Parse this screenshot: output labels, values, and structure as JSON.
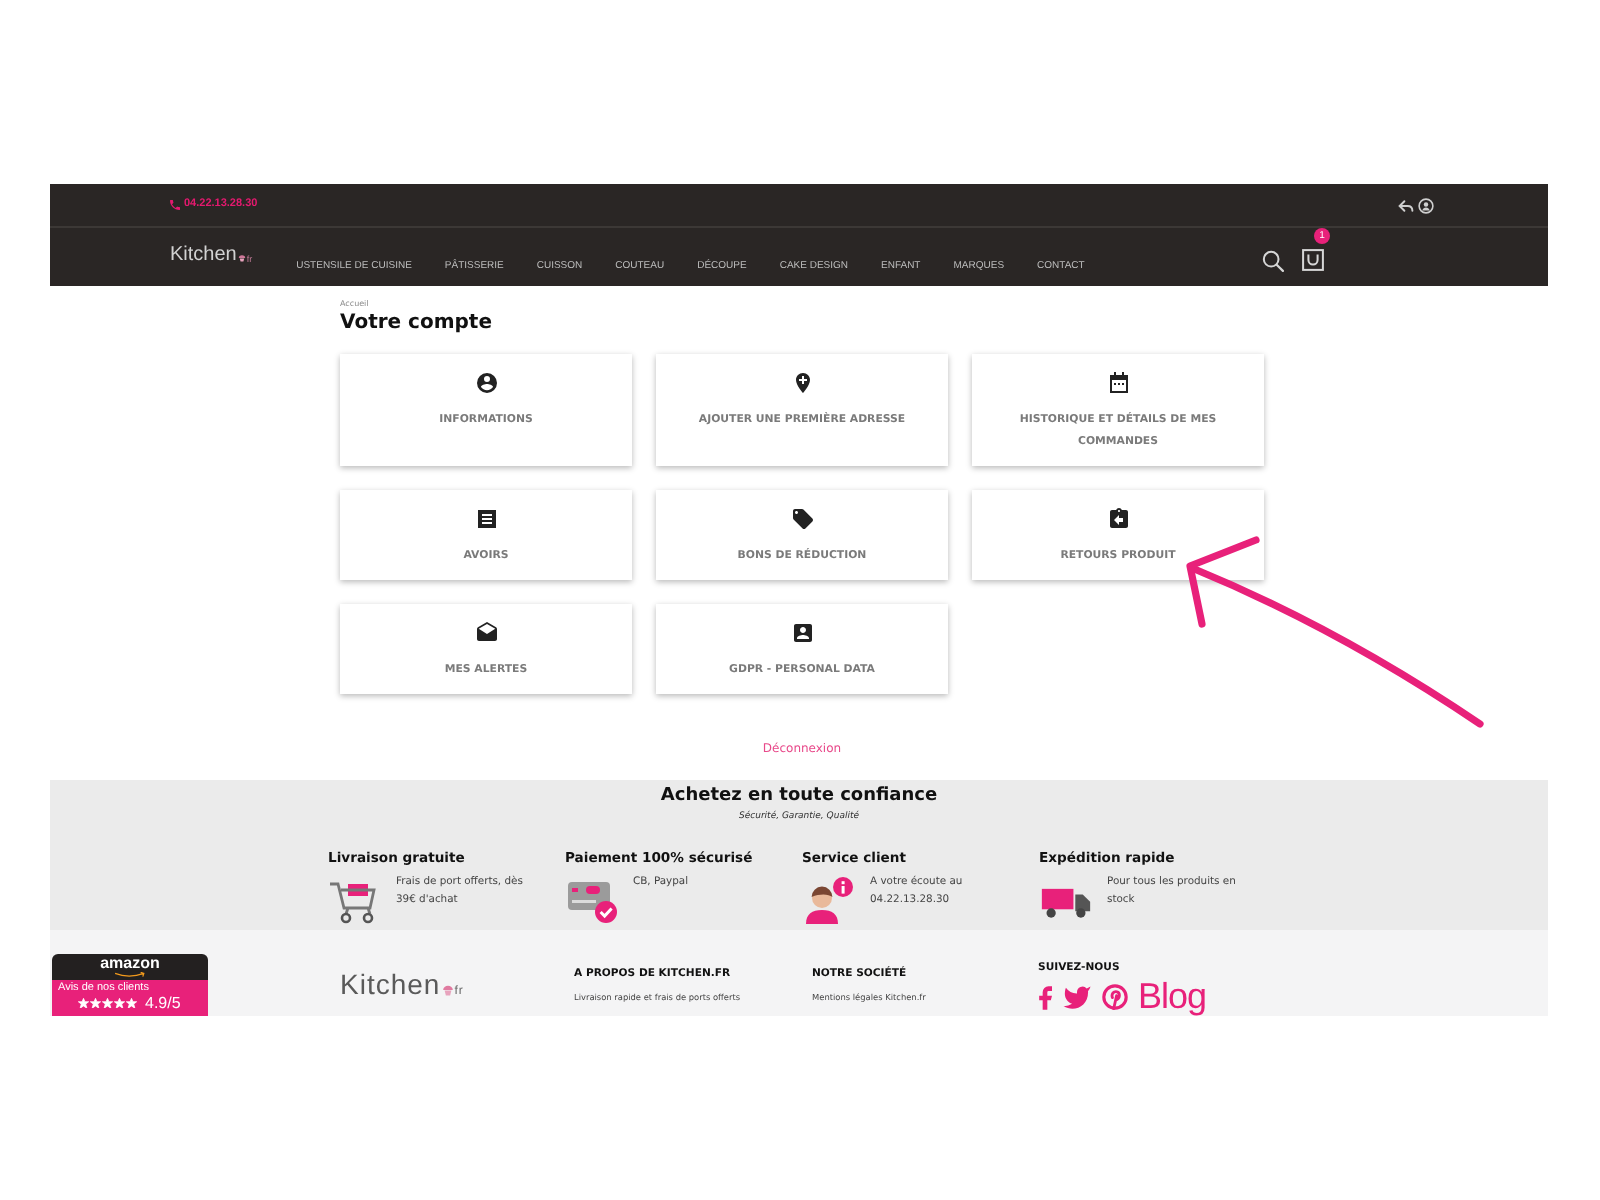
{
  "header": {
    "phone": "04.22.13.28.30",
    "logo": {
      "name": "Kitchen",
      "suffix": "fr"
    },
    "nav": [
      "USTENSILE DE CUISINE",
      "PÂTISSERIE",
      "CUISSON",
      "COUTEAU",
      "DÉCOUPE",
      "CAKE DESIGN",
      "ENFANT",
      "MARQUES",
      "CONTACT"
    ],
    "cart_count": "1"
  },
  "breadcrumb": [
    "Accueil"
  ],
  "page_title": "Votre compte",
  "account_links": [
    {
      "kind": "user",
      "label": "INFORMATIONS"
    },
    {
      "kind": "add-address",
      "label": "AJOUTER UNE PREMIÈRE ADRESSE"
    },
    {
      "kind": "orders",
      "label": "HISTORIQUE ET DÉTAILS DE MES COMMANDES"
    },
    {
      "kind": "credit-slips",
      "label": "AVOIRS"
    },
    {
      "kind": "vouchers",
      "label": "BONS DE RÉDUCTION"
    },
    {
      "kind": "returns",
      "label": "RETOURS PRODUIT"
    },
    {
      "kind": "alerts",
      "label": "MES ALERTES"
    },
    {
      "kind": "gdpr",
      "label": "GDPR - PERSONAL DATA"
    }
  ],
  "logout": "Déconnexion",
  "trust": {
    "title": "Achetez en toute confiance",
    "subtitle": "Sécurité, Garantie, Qualité",
    "features": [
      {
        "kind": "delivery",
        "title": "Livraison gratuite",
        "text": "Frais de port offerts, dès 39€ d'achat"
      },
      {
        "kind": "payment",
        "title": "Paiement 100% sécurisé",
        "text": "CB, Paypal"
      },
      {
        "kind": "support",
        "title": "Service client",
        "text": "A votre écoute au 04.22.13.28.30"
      },
      {
        "kind": "shipping",
        "title": "Expédition rapide",
        "text": "Pour tous les produits en stock"
      }
    ]
  },
  "footer": {
    "rating_badge": {
      "brand": "amazon",
      "label": "Avis de nos clients",
      "stars": 5,
      "score": "4.9/5"
    },
    "logo": {
      "name": "Kitchen",
      "suffix": "fr"
    },
    "columns": [
      {
        "heading": "A PROPOS DE KITCHEN.FR",
        "links": [
          "Livraison rapide et frais de ports offerts"
        ]
      },
      {
        "heading": "NOTRE SOCIÉTÉ",
        "links": [
          "Mentions légales Kitchen.fr"
        ]
      }
    ],
    "social": {
      "heading": "SUIVEZ-NOUS",
      "links": [
        {
          "kind": "facebook"
        },
        {
          "kind": "twitter"
        },
        {
          "kind": "pinterest"
        },
        {
          "kind": "blog",
          "label": "Blog"
        }
      ]
    }
  },
  "annotations": [
    {
      "kind": "arrow"
    }
  ]
}
